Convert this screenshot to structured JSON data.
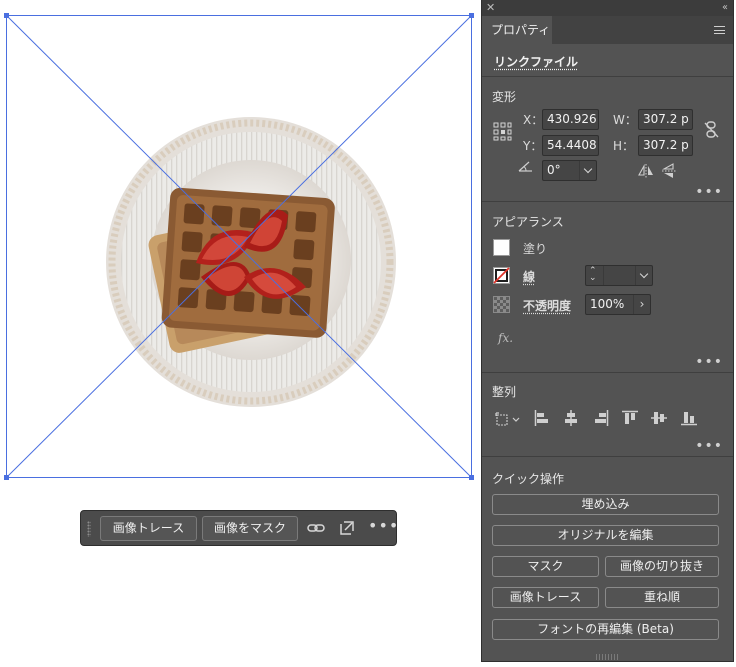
{
  "canvas": {
    "image": "waffles-strawberries-plate",
    "selection_color": "#4a6fe0"
  },
  "taskbar": {
    "trace_label": "画像トレース",
    "mask_label": "画像をマスク",
    "icons": [
      "link-icon",
      "place-icon",
      "more-icon"
    ]
  },
  "panel": {
    "tab_label": "プロパティ",
    "link_file": "リンクファイル",
    "transform": {
      "title": "変形",
      "x_label": "X：",
      "x_value": "430.926",
      "y_label": "Y：",
      "y_value": "54.4408",
      "w_label": "W：",
      "w_value": "307.2 p",
      "h_label": "H：",
      "h_value": "307.2 p",
      "angle_value": "0°"
    },
    "appearance": {
      "title": "アピアランス",
      "fill_label": "塗り",
      "stroke_label": "線",
      "opacity_label": "不透明度",
      "opacity_value": "100%",
      "fx_label": "fx."
    },
    "align": {
      "title": "整列"
    },
    "quick": {
      "title": "クイック操作",
      "embed": "埋め込み",
      "edit_original": "オリジナルを編集",
      "mask": "マスク",
      "crop": "画像の切り抜き",
      "trace": "画像トレース",
      "arrange": "重ね順",
      "reedit_fonts": "フォントの再編集 (Beta)"
    },
    "colors": {
      "panel_bg": "#535353",
      "field_bg": "#454545",
      "stroke_red": "#e0342b"
    }
  }
}
